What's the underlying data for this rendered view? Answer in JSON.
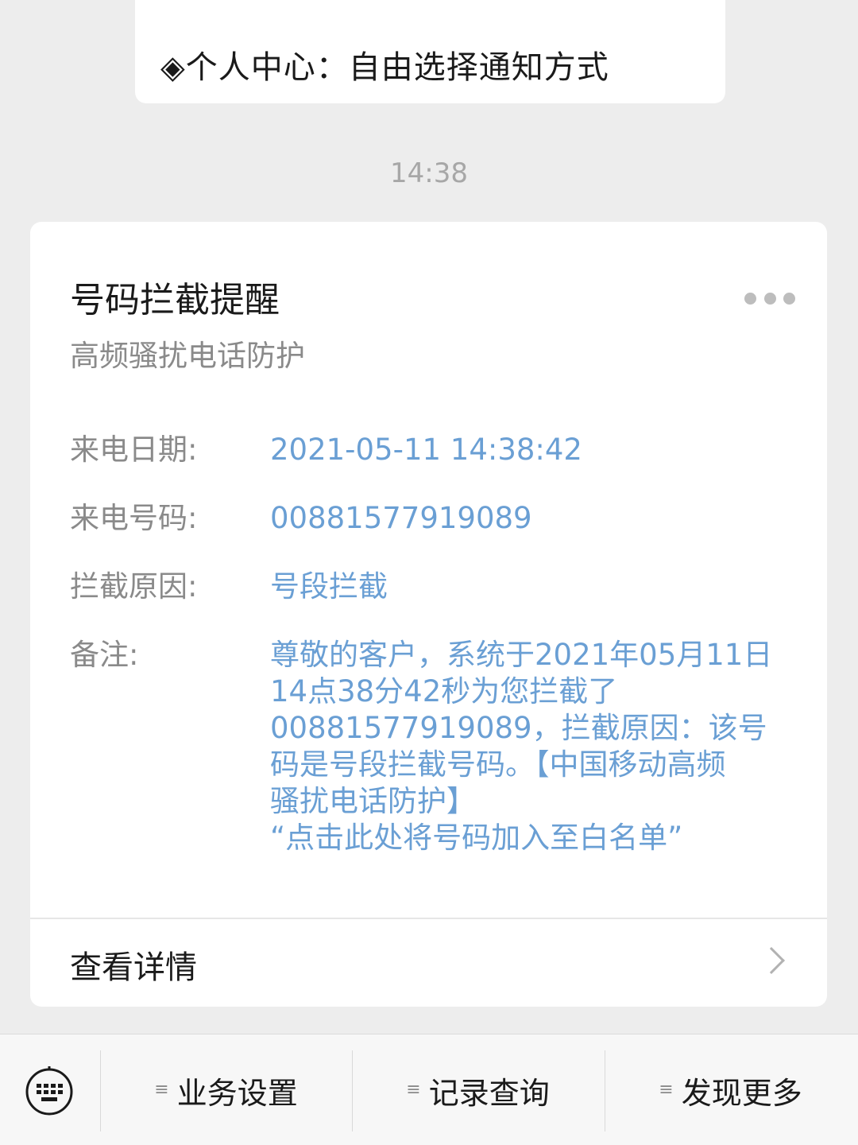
{
  "previous_message": {
    "text": "◈个人中心：自由选择通知方式"
  },
  "timestamp": "14:38",
  "card": {
    "title": "号码拦截提醒",
    "subtitle": "高频骚扰电话防护",
    "fields": [
      {
        "label": "来电日期:",
        "value": "2021-05-11 14:38:42"
      },
      {
        "label": "来电号码:",
        "value": "00881577919089"
      },
      {
        "label": "拦截原因:",
        "value": "号段拦截"
      },
      {
        "label": "备注:",
        "value": "尊敬的客户，系统于2021年05月11日\n14点38分42秒为您拦截了\n00881577919089，拦截原因：该号\n码是号段拦截号码。【中国移动高频\n骚扰电话防护】\n“点击此处将号码加入至白名单”"
      }
    ],
    "details_label": "查看详情"
  },
  "menu": {
    "items": [
      {
        "label": "业务设置",
        "glyph": "≡"
      },
      {
        "label": "记录查询",
        "glyph": "≡"
      },
      {
        "label": "发现更多",
        "glyph": "≡"
      }
    ]
  },
  "colors": {
    "background": "#ededed",
    "card": "#ffffff",
    "link_value": "#6a9fd4",
    "label_gray": "#8a8a8a"
  },
  "icons": {
    "more": "more-dots-icon",
    "chevron": "chevron-right-icon",
    "keyboard": "keyboard-icon"
  }
}
